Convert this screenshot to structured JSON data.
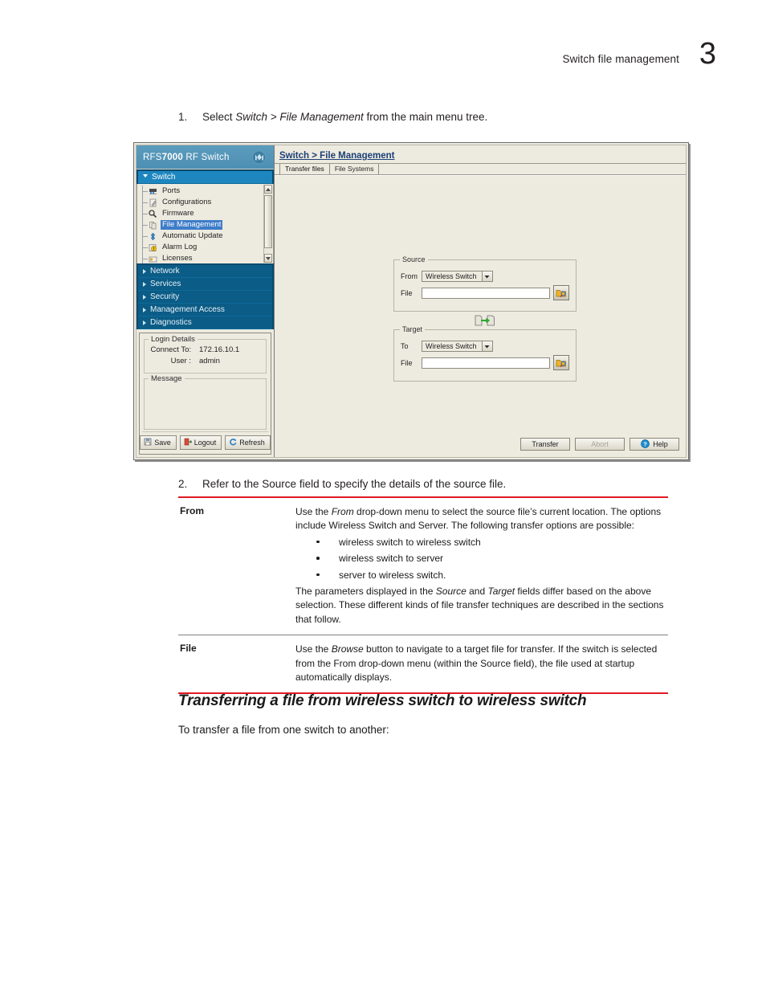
{
  "header": {
    "running_head": "Switch file management",
    "chapter_number": "3"
  },
  "steps": {
    "step1": {
      "num": "1.",
      "prefix": "Select ",
      "italic1": "Switch > File Management",
      "suffix": " from the main menu tree."
    },
    "step2": {
      "num": "2.",
      "text": "Refer to the Source field to specify the details of the source file."
    }
  },
  "app": {
    "brand": {
      "prefix": "RFS",
      "bold": "7000",
      "suffix": " RF Switch",
      "logo": "motorola-m-logo"
    },
    "nav_groups": [
      {
        "label": "Switch",
        "open": true
      },
      {
        "label": "Network",
        "open": false
      },
      {
        "label": "Services",
        "open": false
      },
      {
        "label": "Security",
        "open": false
      },
      {
        "label": "Management Access",
        "open": false
      },
      {
        "label": "Diagnostics",
        "open": false
      }
    ],
    "tree_items": [
      {
        "label": "Ports",
        "icon": "ports-icon",
        "selected": false
      },
      {
        "label": "Configurations",
        "icon": "configurations-icon",
        "selected": false
      },
      {
        "label": "Firmware",
        "icon": "firmware-icon",
        "selected": false
      },
      {
        "label": "File Management",
        "icon": "file-management-icon",
        "selected": true
      },
      {
        "label": "Automatic Update",
        "icon": "automatic-update-icon",
        "selected": false
      },
      {
        "label": "Alarm Log",
        "icon": "alarm-log-icon",
        "selected": false
      },
      {
        "label": "Licenses",
        "icon": "licenses-icon",
        "selected": false
      }
    ],
    "login_details": {
      "legend": "Login Details",
      "connect_to_label": "Connect To:",
      "connect_to_value": "172.16.10.1",
      "user_label": "User :",
      "user_value": "admin"
    },
    "message": {
      "legend": "Message",
      "value": ""
    },
    "left_buttons": [
      {
        "label": "Save",
        "icon": "save-icon"
      },
      {
        "label": "Logout",
        "icon": "logout-icon"
      },
      {
        "label": "Refresh",
        "icon": "refresh-icon"
      }
    ],
    "breadcrumb": "Switch > File Management",
    "tabs": [
      {
        "label": "Transfer files",
        "active": true
      },
      {
        "label": "File Systems",
        "active": false
      }
    ],
    "source": {
      "legend": "Source",
      "from_label": "From",
      "from_value": "Wireless Switch",
      "file_label": "File",
      "file_value": "",
      "browse_icon": "browse-folder-icon"
    },
    "transfer_icon": "file-transfer-icon",
    "target": {
      "legend": "Target",
      "to_label": "To",
      "to_value": "Wireless Switch",
      "file_label": "File",
      "file_value": "",
      "browse_icon": "browse-folder-icon"
    },
    "bottom_buttons": [
      {
        "label": "Transfer",
        "disabled": false,
        "icon": ""
      },
      {
        "label": "Abort",
        "disabled": true,
        "icon": ""
      },
      {
        "label": "Help",
        "disabled": false,
        "icon": "help-icon"
      }
    ]
  },
  "def_table": {
    "rows": [
      {
        "term": "From",
        "p1_a": "Use the ",
        "p1_i": "From",
        "p1_b": " drop-down menu to select the source file’s current location. The options include Wireless Switch and Server. The following transfer options are possible:",
        "bullets": [
          "wireless switch to wireless switch",
          "wireless switch to server",
          "server to wireless switch."
        ],
        "p2_a": "The parameters displayed in the ",
        "p2_i1": "Source",
        "p2_b": " and ",
        "p2_i2": "Target",
        "p2_c": " fields differ based on the above selection. These different kinds of file transfer techniques are described in the sections that follow."
      },
      {
        "term": "File",
        "p1_a": "Use the ",
        "p1_i": "Browse",
        "p1_b": " button to navigate to a target file for transfer. If the switch is selected from the From drop-down menu (within the Source field), the file used at startup automatically displays."
      }
    ]
  },
  "section": {
    "heading": "Transferring a file from wireless switch to wireless switch",
    "paragraph": "To transfer a file from one switch to another:"
  },
  "colors": {
    "accent_red": "#e01a22",
    "brand_blue": "#074a70",
    "nav_open_blue": "#1e86bf",
    "app_bg": "#edeadf",
    "selection_blue": "#3d7cc9"
  }
}
